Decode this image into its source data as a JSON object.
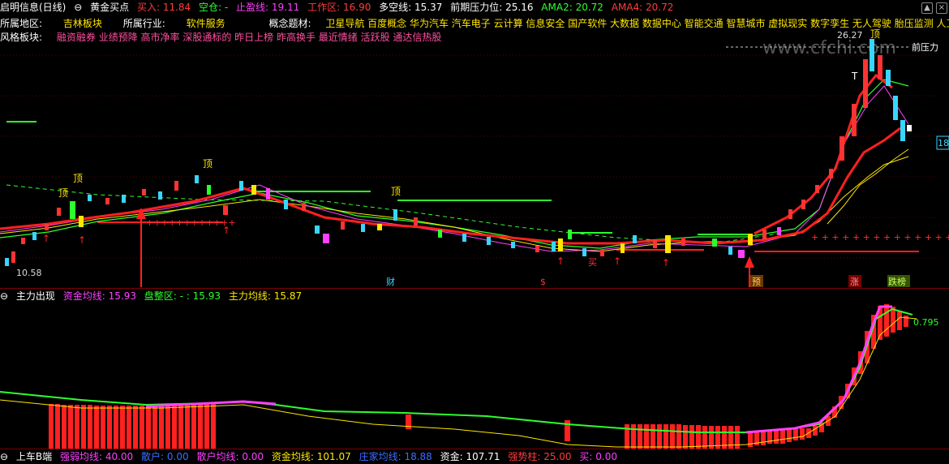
{
  "window": {
    "title": "启明信息(日线)"
  },
  "indicator1": {
    "name": "黄金买点",
    "buy_label": "买入:",
    "buy_value": "11.84",
    "empty_label": "空仓:",
    "empty_value": "-",
    "stop_label": "止盈线:",
    "stop_value": "19.11",
    "work_label": "工作区:",
    "work_value": "16.90",
    "ls_label": "多空线:",
    "ls_value": "15.37",
    "pressure_label": "前期压力位:",
    "pressure_value": "25.16",
    "ama2_label": "AMA2:",
    "ama2_value": "20.72",
    "ama4_label": "AMA4:",
    "ama4_value": "20.72"
  },
  "stock_info": {
    "region_label": "所属地区:",
    "region": "吉林板块",
    "industry_label": "所属行业:",
    "industry": "软件服务",
    "concept_label": "概念题材:",
    "concepts": "卫星导航 百度概念 华为汽车 汽车电子 云计算 信息安全 国产软件 大数据 数据中心 智能交通 智慧城市 虚拟现实 数字孪生 无人驾驶 胎压监测 人工",
    "style_label": "风格板块:",
    "styles": "融资融券 业绩预降 高市净率 深股通标的 昨日上榜 昨高换手 最近情绪 活跃股 通达信热股"
  },
  "main_chart_labels": {
    "high_price": "26.27",
    "high_mark": "顶",
    "low_price": "10.58",
    "pressure_text": "前压力",
    "watermark": "www.cfchi.com",
    "right_price": "18",
    "markers": [
      "财",
      "$",
      "预",
      "涨",
      "跌榜"
    ],
    "top_marks": [
      "顶",
      "顶",
      "顶",
      "顶"
    ],
    "buy_mark": "买",
    "t_mark": "T"
  },
  "indicator2": {
    "name": "主力出现",
    "fund_label": "资金均线:",
    "fund_value": "15.93",
    "consol_label": "盘整区:",
    "consol_value": "- : 15.93",
    "main_label": "主力均线:",
    "main_value": "15.87",
    "right_value": "0.795"
  },
  "indicator3": {
    "name": "上车B端",
    "items": [
      {
        "label": "强弱均线:",
        "value": "40.00"
      },
      {
        "label": "散户:",
        "value": "0.00"
      },
      {
        "label": "散户均线:",
        "value": "0.00"
      },
      {
        "label": "资金均线:",
        "value": "101.07"
      },
      {
        "label": "庄家均线:",
        "value": "18.88"
      },
      {
        "label": "资金:",
        "value": "107.71"
      },
      {
        "label": "强势柱:",
        "value": "25.00"
      },
      {
        "label": "买:",
        "value": "0.00"
      }
    ]
  },
  "colors": {
    "up": "#ff3333",
    "down": "#38d6ff",
    "ma_green": "#2dff2d",
    "ma_yellow": "#ffe600",
    "ma_magenta": "#ff40ff"
  }
}
